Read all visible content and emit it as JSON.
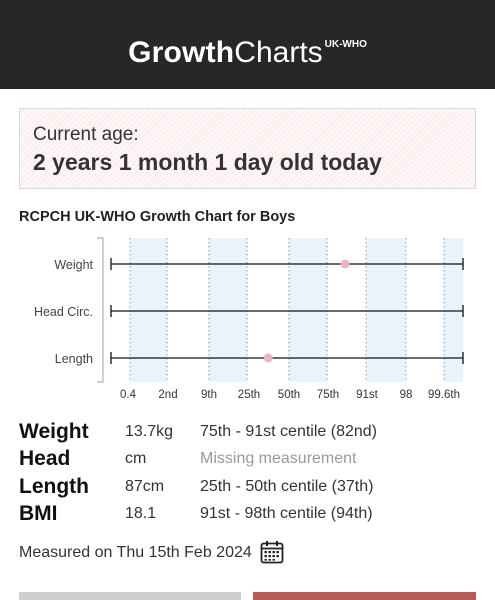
{
  "header": {
    "logo_growth": "Growth",
    "logo_charts": "Charts",
    "logo_super": "UK-WHO"
  },
  "age": {
    "label": "Current age:",
    "value": "2 years 1 month 1 day old today"
  },
  "chart_title": "RCPCH UK-WHO Growth Chart for Boys",
  "chart_data": {
    "type": "scatter",
    "title": "RCPCH UK-WHO Growth Chart for Boys",
    "categories": [
      "Weight",
      "Head Circ.",
      "Length"
    ],
    "x_tick_labels": [
      "0.4",
      "2nd",
      "9th",
      "25th",
      "50th",
      "75th",
      "91st",
      "98",
      "99.6th"
    ],
    "x_ticks": [
      0.4,
      2,
      9,
      25,
      50,
      75,
      91,
      98,
      99.6
    ],
    "points": [
      {
        "category": "Weight",
        "centile": 82
      },
      {
        "category": "Length",
        "centile": 37
      }
    ],
    "xlabel": "",
    "ylabel": "",
    "point_color": "#f0b3bc",
    "band_color": "#e8f3fb",
    "grid": true
  },
  "stats": [
    {
      "name": "Weight",
      "value": "13.7kg",
      "centile": "75th - 91st centile (82nd)",
      "missing": false
    },
    {
      "name": "Head",
      "value": "cm",
      "centile": "Missing measurement",
      "missing": true
    },
    {
      "name": "Length",
      "value": "87cm",
      "centile": "25th - 50th centile (37th)",
      "missing": false
    },
    {
      "name": "BMI",
      "value": "18.1",
      "centile": "91st - 98th centile (94th)",
      "missing": false
    }
  ],
  "measured_on": "Measured on Thu 15th Feb 2024",
  "icons": {
    "calendar": "calendar-icon"
  },
  "colors": {
    "header_bg": "#272727",
    "accent_button": "#b85c56",
    "secondary_button": "#cfcfcf"
  }
}
